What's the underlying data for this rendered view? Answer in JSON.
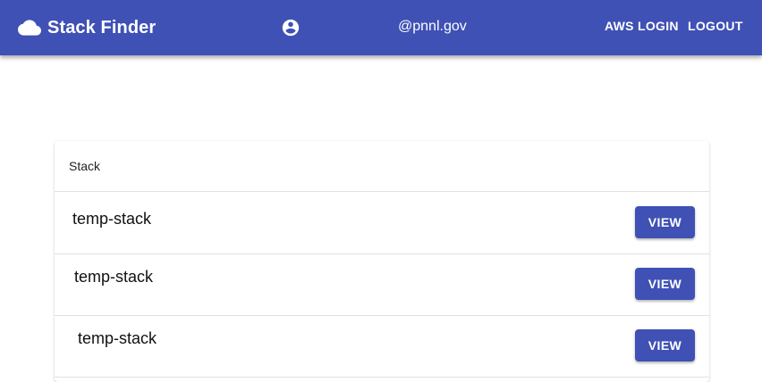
{
  "appbar": {
    "title": "Stack Finder",
    "brand_icon": "cloud-icon",
    "account_icon": "account-circle-icon",
    "user_email": "@pnnl.gov",
    "aws_login_label": "AWS LOGIN",
    "logout_label": "LOGOUT",
    "color": "#3f51b5"
  },
  "table": {
    "header": "Stack",
    "rows": [
      {
        "name": "temp-stack",
        "action": "VIEW"
      },
      {
        "name": "temp-stack",
        "action": "VIEW"
      },
      {
        "name": "temp-stack",
        "action": "VIEW"
      }
    ]
  }
}
